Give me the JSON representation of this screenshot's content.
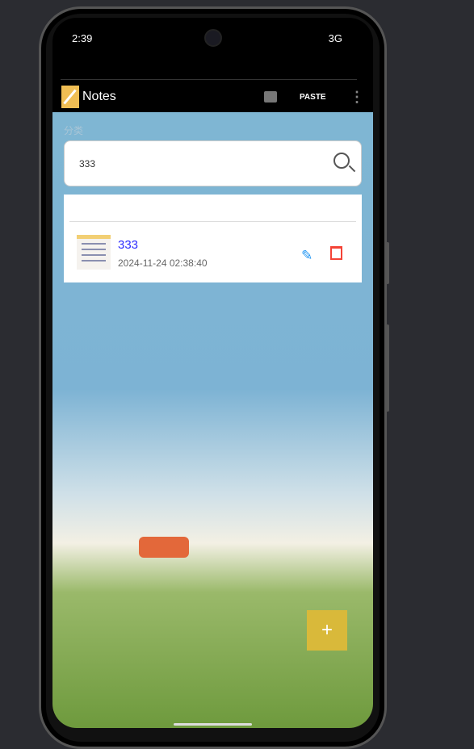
{
  "status": {
    "time": "2:39",
    "network": "3G"
  },
  "appbar": {
    "title": "Notes",
    "paste_label": "PASTE"
  },
  "category_label": "分类",
  "search": {
    "value": "333"
  },
  "notes": [
    {
      "title": "333",
      "date": "2024-11-24 02:38:40"
    }
  ],
  "fab_label": "+"
}
